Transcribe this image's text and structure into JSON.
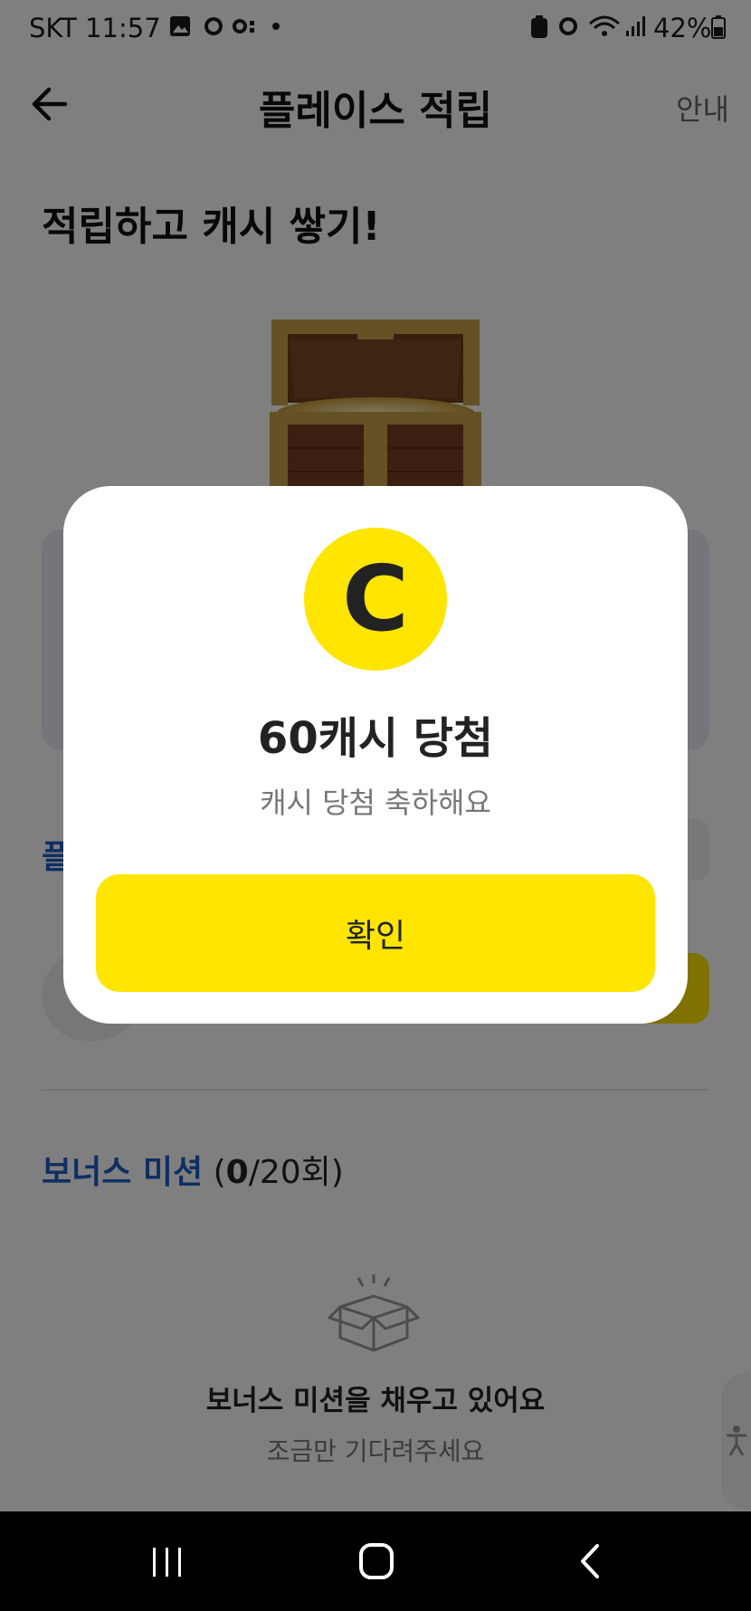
{
  "status_bar": {
    "carrier_time": "SKT 11:57",
    "battery": "42%"
  },
  "header": {
    "title": "플레이스 적립",
    "guide": "안내"
  },
  "headline": "적립하고 캐시 쌓기!",
  "place_section": {
    "title_partial": "플"
  },
  "bonus": {
    "title": "보너스 미션",
    "count_open": "(",
    "count_done": "0",
    "count_rest": "/20회)",
    "empty_title": "보너스 미션을 채우고 있어요",
    "empty_sub": "조금만 기다려주세요"
  },
  "modal": {
    "coin_letter": "C",
    "title": "60캐시 당첨",
    "subtitle": "캐시 당첨 축하해요",
    "confirm_label": "확인"
  },
  "colors": {
    "accent_yellow": "#ffe500",
    "link_blue": "#1f5fc4",
    "overlay": "rgba(0,0,0,0.5)"
  },
  "icons": [
    "back-arrow-icon",
    "treasure-chest-image",
    "open-box-icon",
    "accessibility-icon",
    "recents-icon",
    "home-icon",
    "nav-back-icon",
    "gallery-icon",
    "alarm-icon",
    "wifi-icon",
    "signal-icon",
    "battery-icon"
  ]
}
